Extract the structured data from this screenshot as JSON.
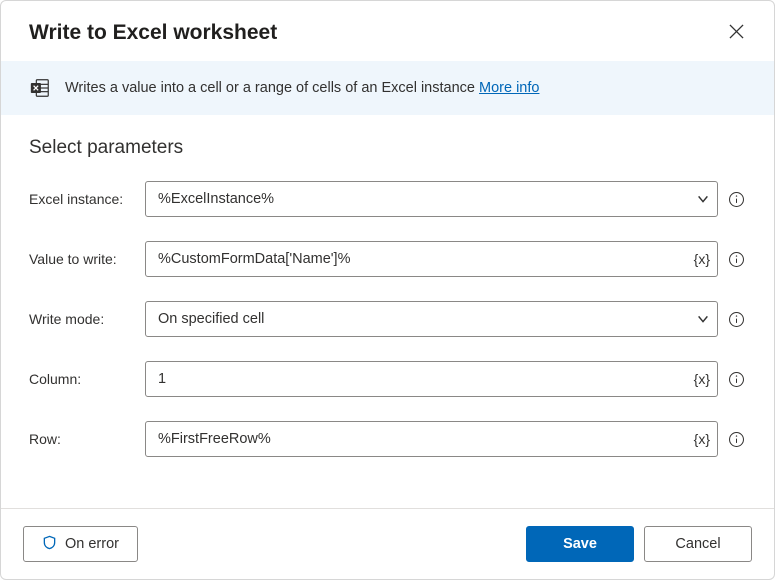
{
  "dialog": {
    "title": "Write to Excel worksheet"
  },
  "info": {
    "text": "Writes a value into a cell or a range of cells of an Excel instance ",
    "link": "More info"
  },
  "section": {
    "title": "Select parameters"
  },
  "fields": {
    "excel_instance": {
      "label": "Excel instance:",
      "value": "%ExcelInstance%"
    },
    "value_to_write": {
      "label": "Value to write:",
      "value": "%CustomFormData['Name']%"
    },
    "write_mode": {
      "label": "Write mode:",
      "value": "On specified cell"
    },
    "column": {
      "label": "Column:",
      "value": "1"
    },
    "row": {
      "label": "Row:",
      "value": "%FirstFreeRow%"
    }
  },
  "footer": {
    "on_error": "On error",
    "save": "Save",
    "cancel": "Cancel"
  }
}
